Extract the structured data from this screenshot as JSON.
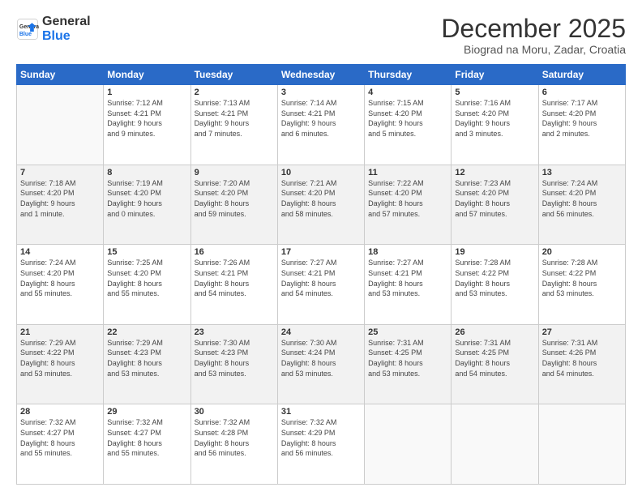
{
  "logo": {
    "line1": "General",
    "line2": "Blue"
  },
  "title": "December 2025",
  "subtitle": "Biograd na Moru, Zadar, Croatia",
  "days_header": [
    "Sunday",
    "Monday",
    "Tuesday",
    "Wednesday",
    "Thursday",
    "Friday",
    "Saturday"
  ],
  "weeks": [
    [
      {
        "day": "",
        "text": ""
      },
      {
        "day": "1",
        "text": "Sunrise: 7:12 AM\nSunset: 4:21 PM\nDaylight: 9 hours\nand 9 minutes."
      },
      {
        "day": "2",
        "text": "Sunrise: 7:13 AM\nSunset: 4:21 PM\nDaylight: 9 hours\nand 7 minutes."
      },
      {
        "day": "3",
        "text": "Sunrise: 7:14 AM\nSunset: 4:21 PM\nDaylight: 9 hours\nand 6 minutes."
      },
      {
        "day": "4",
        "text": "Sunrise: 7:15 AM\nSunset: 4:20 PM\nDaylight: 9 hours\nand 5 minutes."
      },
      {
        "day": "5",
        "text": "Sunrise: 7:16 AM\nSunset: 4:20 PM\nDaylight: 9 hours\nand 3 minutes."
      },
      {
        "day": "6",
        "text": "Sunrise: 7:17 AM\nSunset: 4:20 PM\nDaylight: 9 hours\nand 2 minutes."
      }
    ],
    [
      {
        "day": "7",
        "text": "Sunrise: 7:18 AM\nSunset: 4:20 PM\nDaylight: 9 hours\nand 1 minute."
      },
      {
        "day": "8",
        "text": "Sunrise: 7:19 AM\nSunset: 4:20 PM\nDaylight: 9 hours\nand 0 minutes."
      },
      {
        "day": "9",
        "text": "Sunrise: 7:20 AM\nSunset: 4:20 PM\nDaylight: 8 hours\nand 59 minutes."
      },
      {
        "day": "10",
        "text": "Sunrise: 7:21 AM\nSunset: 4:20 PM\nDaylight: 8 hours\nand 58 minutes."
      },
      {
        "day": "11",
        "text": "Sunrise: 7:22 AM\nSunset: 4:20 PM\nDaylight: 8 hours\nand 57 minutes."
      },
      {
        "day": "12",
        "text": "Sunrise: 7:23 AM\nSunset: 4:20 PM\nDaylight: 8 hours\nand 57 minutes."
      },
      {
        "day": "13",
        "text": "Sunrise: 7:24 AM\nSunset: 4:20 PM\nDaylight: 8 hours\nand 56 minutes."
      }
    ],
    [
      {
        "day": "14",
        "text": "Sunrise: 7:24 AM\nSunset: 4:20 PM\nDaylight: 8 hours\nand 55 minutes."
      },
      {
        "day": "15",
        "text": "Sunrise: 7:25 AM\nSunset: 4:20 PM\nDaylight: 8 hours\nand 55 minutes."
      },
      {
        "day": "16",
        "text": "Sunrise: 7:26 AM\nSunset: 4:21 PM\nDaylight: 8 hours\nand 54 minutes."
      },
      {
        "day": "17",
        "text": "Sunrise: 7:27 AM\nSunset: 4:21 PM\nDaylight: 8 hours\nand 54 minutes."
      },
      {
        "day": "18",
        "text": "Sunrise: 7:27 AM\nSunset: 4:21 PM\nDaylight: 8 hours\nand 53 minutes."
      },
      {
        "day": "19",
        "text": "Sunrise: 7:28 AM\nSunset: 4:22 PM\nDaylight: 8 hours\nand 53 minutes."
      },
      {
        "day": "20",
        "text": "Sunrise: 7:28 AM\nSunset: 4:22 PM\nDaylight: 8 hours\nand 53 minutes."
      }
    ],
    [
      {
        "day": "21",
        "text": "Sunrise: 7:29 AM\nSunset: 4:22 PM\nDaylight: 8 hours\nand 53 minutes."
      },
      {
        "day": "22",
        "text": "Sunrise: 7:29 AM\nSunset: 4:23 PM\nDaylight: 8 hours\nand 53 minutes."
      },
      {
        "day": "23",
        "text": "Sunrise: 7:30 AM\nSunset: 4:23 PM\nDaylight: 8 hours\nand 53 minutes."
      },
      {
        "day": "24",
        "text": "Sunrise: 7:30 AM\nSunset: 4:24 PM\nDaylight: 8 hours\nand 53 minutes."
      },
      {
        "day": "25",
        "text": "Sunrise: 7:31 AM\nSunset: 4:25 PM\nDaylight: 8 hours\nand 53 minutes."
      },
      {
        "day": "26",
        "text": "Sunrise: 7:31 AM\nSunset: 4:25 PM\nDaylight: 8 hours\nand 54 minutes."
      },
      {
        "day": "27",
        "text": "Sunrise: 7:31 AM\nSunset: 4:26 PM\nDaylight: 8 hours\nand 54 minutes."
      }
    ],
    [
      {
        "day": "28",
        "text": "Sunrise: 7:32 AM\nSunset: 4:27 PM\nDaylight: 8 hours\nand 55 minutes."
      },
      {
        "day": "29",
        "text": "Sunrise: 7:32 AM\nSunset: 4:27 PM\nDaylight: 8 hours\nand 55 minutes."
      },
      {
        "day": "30",
        "text": "Sunrise: 7:32 AM\nSunset: 4:28 PM\nDaylight: 8 hours\nand 56 minutes."
      },
      {
        "day": "31",
        "text": "Sunrise: 7:32 AM\nSunset: 4:29 PM\nDaylight: 8 hours\nand 56 minutes."
      },
      {
        "day": "",
        "text": ""
      },
      {
        "day": "",
        "text": ""
      },
      {
        "day": "",
        "text": ""
      }
    ]
  ]
}
